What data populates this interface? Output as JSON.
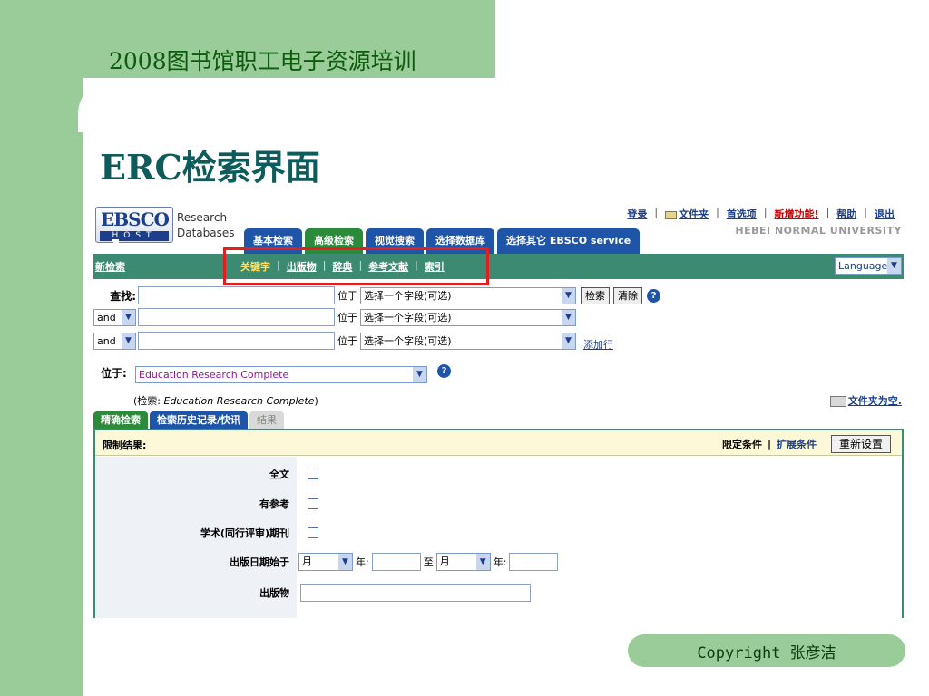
{
  "slide": {
    "header": "2008图书馆职工电子资源培训",
    "title": "ERC检索界面",
    "copyright": "Copyright  张彦洁"
  },
  "colors": {
    "slide_green": "#99cc99",
    "ebsco_blue": "#1f55a8",
    "ebsco_green": "#2c8a3b",
    "nav_teal": "#3c8a71",
    "highlight_red": "#e0201e"
  },
  "app": {
    "logo": {
      "brand": "EBSCO",
      "host": "HOST",
      "research": "Research",
      "databases": "Databases"
    },
    "top_links": {
      "login": "登录",
      "folder": "文件夹",
      "preferences": "首选项",
      "new_features": "新增功能!",
      "help": "帮助",
      "exit": "退出"
    },
    "university": "HEBEI NORMAL UNIVERSITY",
    "tabs": [
      "基本检索",
      "高级检索",
      "视觉搜索",
      "选择数据库",
      "选择其它 EBSCO service"
    ],
    "navbar": {
      "new_search": "新检索",
      "items": [
        "关键字",
        "出版物",
        "辞典",
        "参考文献",
        "索引"
      ],
      "language": "Language"
    },
    "search": {
      "find_label": "查找:",
      "in_label": "位于",
      "field_placeholder": "选择一个字段(可选)",
      "bool_value": "and",
      "search_button": "检索",
      "clear_button": "清除",
      "add_row": "添加行"
    },
    "database": {
      "label": "位于:",
      "selected": "Education Research Complete",
      "searching_prefix": "(检索: ",
      "searching_db": "Education Research Complete",
      "searching_suffix": ")",
      "folder_empty": "文件夹为空."
    },
    "lower_tabs": [
      "精确检索",
      "检索历史记录/快讯",
      "结果"
    ],
    "limits": {
      "header": "限制结果:",
      "limiters": "限定条件",
      "expanders": "扩展条件",
      "reset": "重新设置",
      "full_text": "全文",
      "has_references": "有参考",
      "peer_reviewed": "学术(同行评审)期刊",
      "pub_date_from": "出版日期始于",
      "month": "月",
      "year": "年:",
      "to": "至",
      "publication": "出版物"
    }
  }
}
